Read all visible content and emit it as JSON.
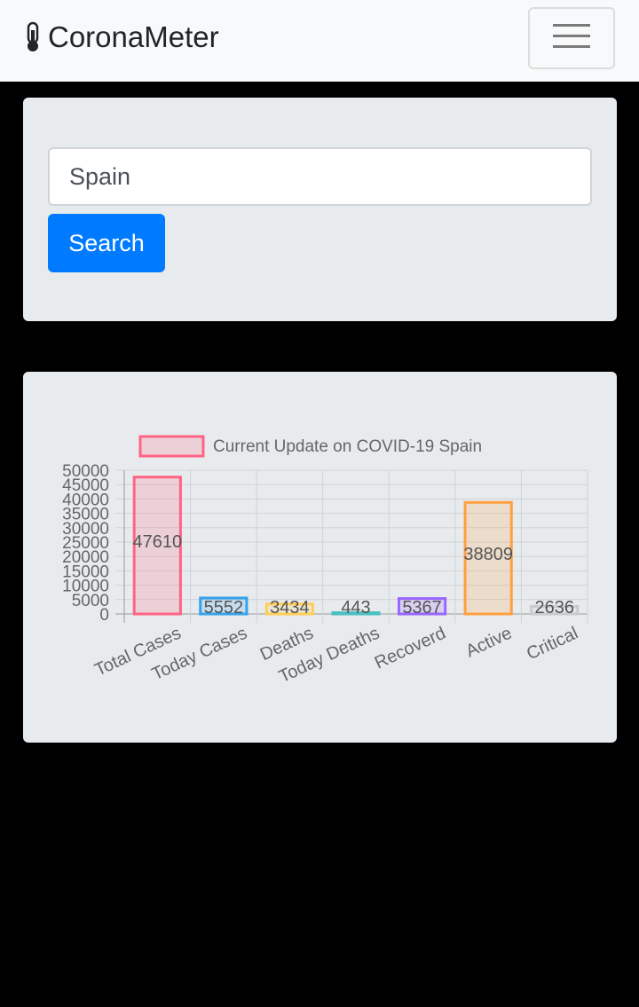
{
  "navbar": {
    "brand_text": "CoronaMeter",
    "brand_icon": "thermometer-icon",
    "toggler_icon": "hamburger-menu-icon"
  },
  "search": {
    "input_value": "Spain",
    "button_label": "Search"
  },
  "colors": {
    "primary": "#007bff",
    "navbar_bg": "#f8f9fa",
    "card_bg": "#e8ebee",
    "page_bg": "#000000"
  },
  "chart_data": {
    "type": "bar",
    "legend": "Current Update on COVID-19 Spain",
    "legend_position": "top",
    "categories": [
      "Total Cases",
      "Today Cases",
      "Deaths",
      "Today Deaths",
      "Recoverd",
      "Active",
      "Critical"
    ],
    "series": [
      {
        "name": "Current Update on COVID-19 Spain",
        "values": [
          47610,
          5552,
          3434,
          443,
          5367,
          38809,
          2636
        ]
      }
    ],
    "bar_colors": [
      "#ff6384",
      "#36a2eb",
      "#ffce56",
      "#4bc0c0",
      "#9966ff",
      "#ff9f40",
      "#c9cbcf"
    ],
    "bar_fills": [
      "rgba(255,99,132,0.2)",
      "rgba(54,162,235,0.2)",
      "rgba(255,206,86,0.2)",
      "rgba(75,192,192,0.2)",
      "rgba(153,102,255,0.2)",
      "rgba(255,159,64,0.2)",
      "rgba(201,203,207,0.2)"
    ],
    "y_ticks": [
      "0",
      "5000",
      "10000",
      "15000",
      "20000",
      "25000",
      "30000",
      "35000",
      "40000",
      "45000",
      "50000"
    ],
    "ylim": [
      0,
      50000
    ],
    "grid": true
  }
}
